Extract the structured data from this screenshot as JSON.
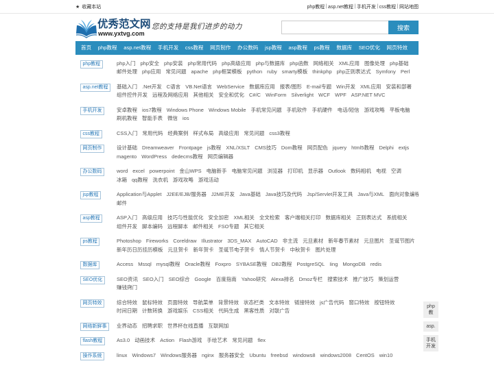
{
  "top_bar": {
    "favorite": "收藏本站",
    "links": [
      "php教程",
      "asp.net教程",
      "手机开发",
      "css教程",
      "网站地图"
    ],
    "separator": "|"
  },
  "header": {
    "site_name": "优秀范文网",
    "site_url": "www.yxtvg.com",
    "slogan": "您的支持是我们进步的动力",
    "search": {
      "value": "",
      "button_label": "搜索"
    }
  },
  "nav": [
    "首页",
    "php教程",
    "asp.net教程",
    "手机开发",
    "css教程",
    "网页制作",
    "办公数码",
    "jsp教程",
    "asp教程",
    "ps教程",
    "数据库",
    "SEO优化",
    "网页特效"
  ],
  "categories": [
    {
      "label": "php教程",
      "lines": [
        [
          "php入门",
          "php安全",
          "php安装",
          "php常用代码",
          "php高级应用",
          "php与数据库",
          "php函数",
          "网络相关",
          "XML应用",
          "图像处理",
          "php基础"
        ],
        [
          "邮件处理",
          "php应用",
          "常见问题",
          "apache",
          "php框架模板",
          "python",
          "ruby",
          "smarty模板",
          "thinkphp",
          "php正则表达式",
          "Symfony",
          "Perl"
        ]
      ]
    },
    {
      "label": "asp.net教程",
      "lines": [
        [
          "基础入门",
          ".Net开发",
          "C语言",
          "VB.Net语言",
          "WebService",
          "数据库应用",
          "报表/图形",
          "E-mail专题",
          "Win开发",
          "XML应用",
          "安装和部署"
        ],
        [
          "组件控件开发",
          "远程及网络应用",
          "其他相关",
          "安全和优化",
          "C#/C",
          "WinForm",
          "Silverlight",
          "WCF",
          "WPF",
          "ASP.NET MVC"
        ]
      ]
    },
    {
      "label": "手机开发",
      "lines": [
        [
          "安卓教程",
          "ios7教程",
          "Windows Phone",
          "Windows Mobile",
          "手机常见问题",
          "手机软件",
          "手机硬件",
          "电话/短信",
          "游戏攻略",
          "平板电脑"
        ],
        [
          "刷机教程",
          "智能手表",
          "微信",
          "ios"
        ]
      ]
    },
    {
      "label": "css教程",
      "lines": [
        [
          "CSS入门",
          "常用代码",
          "经典案例",
          "样式布局",
          "高级应用",
          "常见问题",
          "css3教程"
        ]
      ]
    },
    {
      "label": "网页制作",
      "lines": [
        [
          "设计基础",
          "Dreamweaver",
          "Frontpage",
          "js教程",
          "XNL/XSLT",
          "CMS技巧",
          "Dom教程",
          "网页配色",
          "jquery",
          "html5教程",
          "Delphi",
          "extjs"
        ],
        [
          "magento",
          "WordPress",
          "dedecms教程",
          "网页编辑器"
        ]
      ]
    },
    {
      "label": "办公数码",
      "lines": [
        [
          "word",
          "excel",
          "powerpoint",
          "金山WPS",
          "电脑新手",
          "电脑常见问题",
          "浏览器",
          "打印机",
          "显示器",
          "Outlook",
          "数码相机",
          "电视",
          "空调"
        ],
        [
          "冰箱",
          "qq教程",
          "洗衣机",
          "游戏攻略",
          "游戏活动"
        ]
      ]
    },
    {
      "label": "jsp教程",
      "lines": [
        [
          "Application与Applet",
          "J2EE/EJB/服务器",
          "J2ME开发",
          "Java基础",
          "Java技巧及代码",
          "Jsp/Servlet开发工具",
          "Java与XML",
          "面向对象编程"
        ],
        [
          "邮件"
        ]
      ]
    },
    {
      "label": "asp教程",
      "lines": [
        [
          "ASP入门",
          "高级应用",
          "技巧与性能优化",
          "安全加密",
          "XML相关",
          "全文检索",
          "客户端相关打印",
          "数据库相关",
          "正则表达式",
          "系统相关"
        ],
        [
          "组件开发",
          "脚本编码",
          "远程脚本",
          "邮件相关",
          "FSO专题",
          "其它相关"
        ]
      ]
    },
    {
      "label": "ps教程",
      "lines": [
        [
          "Photoshop",
          "Fireworks",
          "Coreldraw",
          "Illustrator",
          "3DS_MAX",
          "AutoCAD",
          "非主流",
          "元旦素材",
          "新年春节素材",
          "元旦图片",
          "圣诞节图片"
        ],
        [
          "新年历日历挂历模板",
          "元旦贺卡",
          "新年贺卡",
          "圣诞节电子贺卡",
          "情人节贺卡",
          "中秋贺卡",
          "图片处理"
        ]
      ]
    },
    {
      "label": "数据库",
      "lines": [
        [
          "Access",
          "Mssql",
          "mysql教程",
          "Oracle教程",
          "Foxpro",
          "SYBASE教程",
          "DB2教程",
          "PostgreSQL",
          "Iing",
          "MongoDB",
          "redis"
        ]
      ]
    },
    {
      "label": "SEO优化",
      "lines": [
        [
          "SEO资讯",
          "SEO入门",
          "SEO综合",
          "Google",
          "百度指南",
          "Yahoo研究",
          "Alexa排名",
          "Dmoz专栏",
          "搜索技术",
          "推广技巧",
          "策划运营"
        ],
        [
          "赚钱窍门"
        ]
      ]
    },
    {
      "label": "网页特效",
      "lines": [
        [
          "综合特效",
          "鼠标特效",
          "页面特效",
          "导航菜单",
          "背景特效",
          "状态栏类",
          "文本特效",
          "链接特效",
          "js广告代码",
          "窗口特效",
          "按钮特效"
        ],
        [
          "时间日期",
          "计数转换",
          "游戏娱乐",
          "CSS相关",
          "代码生成",
          "黑客性质",
          "对联广告"
        ]
      ]
    },
    {
      "label": "网络新鲜事",
      "lines": [
        [
          "业界动态",
          "招聘求职",
          "世界杯在线直播",
          "互联网加"
        ]
      ]
    },
    {
      "label": "flash教程",
      "lines": [
        [
          "As3.0",
          "动画技术",
          "Action",
          "Flash游戏",
          "手绘艺术",
          "常见问题",
          "flex"
        ]
      ]
    },
    {
      "label": "操作系统",
      "lines": [
        [
          "linux",
          "Windows7",
          "Windows服务器",
          "nginx",
          "服务器安全",
          "Ubuntu",
          "freebsd",
          "windows8",
          "windows2008",
          "CentOS",
          "win10"
        ]
      ]
    }
  ],
  "float_tabs": [
    "php教",
    "asp.",
    "手机开发"
  ],
  "icons": {
    "favorite": "star-icon",
    "logo": "open-book-icon"
  },
  "colors": {
    "accent": "#2b8dbd",
    "label_text": "#2a7ab8",
    "link_text": "#555555"
  }
}
